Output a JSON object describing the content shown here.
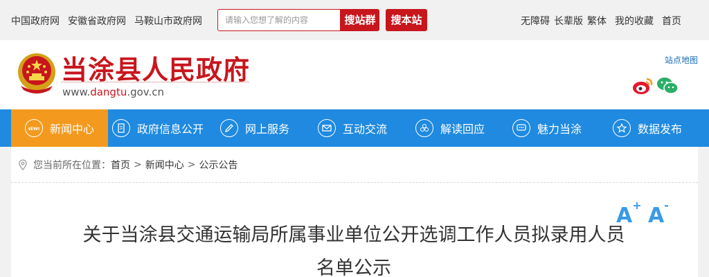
{
  "topbar": {
    "links": [
      "中国政府网",
      "安徽省政府网",
      "马鞍山市政府网"
    ],
    "search_placeholder": "请输入您想了解的内容",
    "search_group_label": "搜站群",
    "search_site_label": "搜本站",
    "right_links": [
      "无障碍",
      "长辈版",
      "繁体",
      "我的收藏",
      "首页"
    ]
  },
  "header": {
    "title": "当涂县人民政府",
    "url_prefix": "www.",
    "url_highlight": "dangtu",
    "url_suffix": ".gov.cn",
    "sitemap_label": "站点地图"
  },
  "nav": {
    "items": [
      {
        "label": "新闻中心",
        "icon": "news-icon",
        "active": true
      },
      {
        "label": "政府信息公开",
        "icon": "document-icon",
        "active": false
      },
      {
        "label": "网上服务",
        "icon": "pen-icon",
        "active": false
      },
      {
        "label": "互动交流",
        "icon": "mail-icon",
        "active": false
      },
      {
        "label": "解读回应",
        "icon": "flower-icon",
        "active": false
      },
      {
        "label": "魅力当涂",
        "icon": "chat-icon",
        "active": false
      },
      {
        "label": "数据发布",
        "icon": "star-icon",
        "active": false
      }
    ]
  },
  "breadcrumb": {
    "prefix": "您当前所在位置：",
    "items": [
      "首页",
      "新闻中心",
      "公示公告"
    ],
    "separator": ">"
  },
  "article": {
    "font_increase": "A",
    "font_increase_sup": "+",
    "font_decrease": "A",
    "font_decrease_sup": "-",
    "title": "关于当涂县交通运输局所属事业单位公开选调工作人员拟录用人员名单公示"
  },
  "colors": {
    "brand_red": "#c8161d",
    "nav_blue": "#1f8ae0",
    "nav_active": "#f39a1e",
    "font_ctrl_blue": "#3a9ae6"
  }
}
